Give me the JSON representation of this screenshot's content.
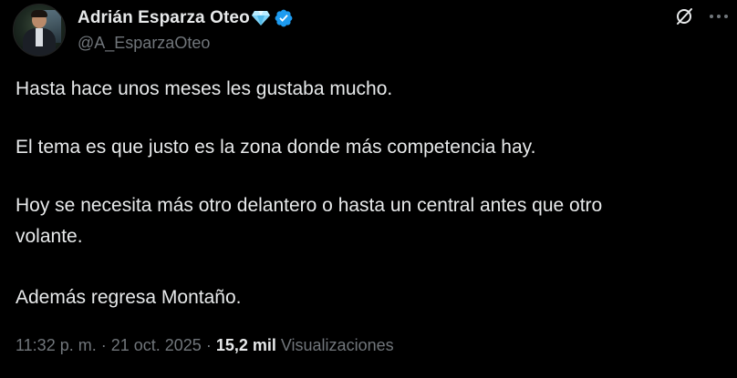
{
  "author": {
    "display_name": "Adrián Esparza Oteo",
    "handle": "@A_EsparzaOteo",
    "badge_icon": "diamond-icon",
    "verified_icon": "verified-icon",
    "verified_color": "#1d9bf0"
  },
  "actions": {
    "grok_icon": "grok-icon",
    "more_icon": "more-icon"
  },
  "tweet": {
    "line1": "Hasta hace unos meses les gustaba mucho.",
    "line2": "El tema es que justo es la zona donde más competencia hay.",
    "line3a": "Hoy se necesita más otro delantero o hasta un central antes que otro",
    "line3b": "volante.",
    "line4": "Además regresa Montaño."
  },
  "meta": {
    "time": "11:32 p. m.",
    "separator1": "·",
    "date": "21 oct. 2025",
    "separator2": "·",
    "views_count": "15,2 mil",
    "views_label": "Visualizaciones"
  },
  "colors": {
    "background": "#000000",
    "primary_text": "#e7e9ea",
    "secondary_text": "#71767b"
  }
}
